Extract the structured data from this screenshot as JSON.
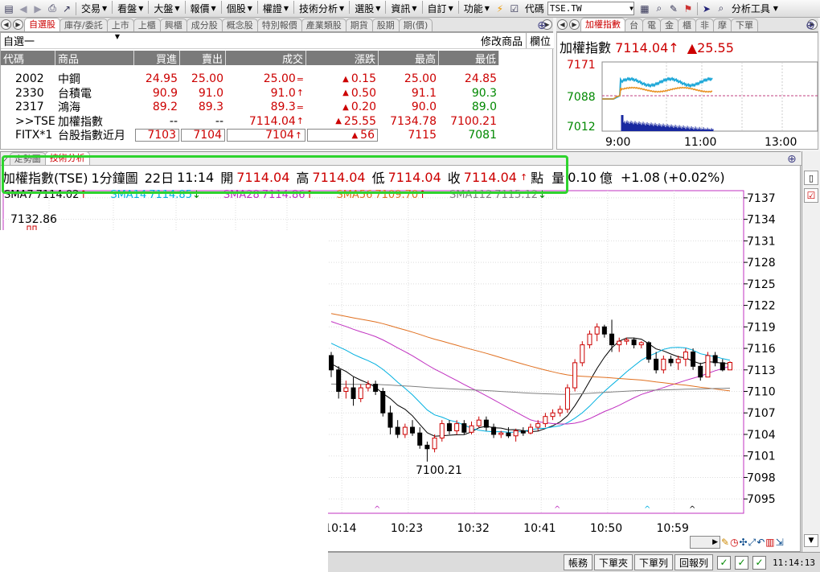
{
  "menu": {
    "items": [
      "交易",
      "看盤",
      "大盤",
      "報價",
      "個股",
      "權證",
      "技術分析",
      "選股",
      "資訊",
      "自訂",
      "功能"
    ],
    "code_label": "代碼",
    "code_value": "TSE.TW",
    "analysis_tool": "分析工具"
  },
  "watch_tabs": [
    "自選股",
    "庫存/委託",
    "上市",
    "上櫃",
    "興櫃",
    "成分股",
    "概念股",
    "特別報價",
    "產業類股",
    "期貨",
    "股期",
    "期(價)"
  ],
  "watch": {
    "group": "自選一",
    "edit_label": "修改商品",
    "column_label": "欄位",
    "columns": [
      "代碼",
      "商品",
      "買進",
      "賣出",
      "成交",
      "漲跌",
      "最高",
      "最低"
    ],
    "rows": [
      {
        "code": "2002",
        "name": "中鋼",
        "bid": "24.95",
        "ask": "25.00",
        "last": "25.00",
        "mark": "=",
        "chg": "0.15",
        "high": "25.00",
        "low": "24.85"
      },
      {
        "code": "2330",
        "name": "台積電",
        "bid": "90.9",
        "ask": "91.0",
        "last": "91.0",
        "mark": "↑",
        "chg": "0.50",
        "high": "91.1",
        "low": "90.3"
      },
      {
        "code": "2317",
        "name": "鴻海",
        "bid": "89.2",
        "ask": "89.3",
        "last": "89.3",
        "mark": "=",
        "chg": "0.20",
        "high": "90.0",
        "low": "89.0"
      },
      {
        "code": ">>TSE",
        "name": "加權指數",
        "bid": "--",
        "ask": "--",
        "last": "7114.04",
        "mark": "↑",
        "chg": "25.55",
        "high": "7134.78",
        "low": "7100.21"
      },
      {
        "code": "FITX*1",
        "name": "台股指數近月",
        "bid": "7103",
        "ask": "7104",
        "last": "7104",
        "mark": "↑",
        "chg": "56",
        "high": "7115",
        "low": "7081"
      }
    ]
  },
  "mini_tabs": [
    "加權指數",
    "台",
    "電",
    "金",
    "櫃",
    "非",
    "摩",
    "下單"
  ],
  "mini": {
    "title": "加權指數",
    "value": "7114.04",
    "arrow": "↑",
    "change": "▲25.55",
    "yticks": [
      "7171",
      "7088",
      "7012"
    ],
    "xticks": [
      "9:00",
      "11:00",
      "13:00"
    ]
  },
  "tech_tabs": [
    "走勢圖",
    "技術分析"
  ],
  "info": {
    "name": "加權指數(TSE)",
    "period": "1分鐘圖",
    "date": "22日",
    "time": "11:14",
    "open_label": "開",
    "open": "7114.04",
    "high_label": "高",
    "high": "7114.04",
    "low_label": "低",
    "low": "7114.04",
    "close_label": "收",
    "close": "7114.04",
    "close_arrow": "↑",
    "unit": "點",
    "vol_label": "量",
    "vol": "0.10",
    "vol_unit": "億",
    "change": "+1.08",
    "pct": "(+0.02%)"
  },
  "ma": [
    {
      "label": "SMA7",
      "value": "7114.02",
      "arrow": "↑",
      "color": "#000000"
    },
    {
      "label": "SMA14",
      "value": "7114.85",
      "arrow": "↓",
      "color": "#00b0e0"
    },
    {
      "label": "SMA28",
      "value": "7114.86",
      "arrow": "↑",
      "color": "#c030c0"
    },
    {
      "label": "SMA56",
      "value": "7109.70",
      "arrow": "↑",
      "color": "#e07020"
    },
    {
      "label": "SMA112",
      "value": "7115.12",
      "arrow": "↓",
      "color": "#808080"
    }
  ],
  "chart_data": {
    "type": "candlestick",
    "yticks": [
      "7137",
      "7134",
      "7131",
      "7128",
      "7125",
      "7122",
      "7119",
      "7116",
      "7113",
      "7110",
      "7107",
      "7104",
      "7101",
      "7098",
      "7095"
    ],
    "xticks": [
      "10:14",
      "10:23",
      "10:32",
      "10:41",
      "10:50",
      "10:59"
    ],
    "ylim": [
      7093,
      7138
    ],
    "high_label": "7132.86",
    "low_label": "7100.21",
    "candles": [
      {
        "o": 7115,
        "h": 7115.5,
        "l": 7112,
        "c": 7113
      },
      {
        "o": 7113,
        "h": 7113.5,
        "l": 7109,
        "c": 7110
      },
      {
        "o": 7110,
        "h": 7111.5,
        "l": 7109,
        "c": 7110.5
      },
      {
        "o": 7110.5,
        "h": 7112,
        "l": 7108,
        "c": 7109
      },
      {
        "o": 7109,
        "h": 7111,
        "l": 7108.5,
        "c": 7110.5
      },
      {
        "o": 7110.5,
        "h": 7111.5,
        "l": 7110,
        "c": 7111
      },
      {
        "o": 7111,
        "h": 7111.5,
        "l": 7109.5,
        "c": 7110
      },
      {
        "o": 7110,
        "h": 7110.5,
        "l": 7106.5,
        "c": 7107
      },
      {
        "o": 7107,
        "h": 7108,
        "l": 7104,
        "c": 7105
      },
      {
        "o": 7105,
        "h": 7106,
        "l": 7103.5,
        "c": 7104
      },
      {
        "o": 7104,
        "h": 7105.5,
        "l": 7103.5,
        "c": 7105
      },
      {
        "o": 7105,
        "h": 7106,
        "l": 7103.8,
        "c": 7104.2
      },
      {
        "o": 7104.2,
        "h": 7105,
        "l": 7102,
        "c": 7102.5
      },
      {
        "o": 7102.5,
        "h": 7103,
        "l": 7100.21,
        "c": 7102
      },
      {
        "o": 7102,
        "h": 7104,
        "l": 7101.5,
        "c": 7103.5
      },
      {
        "o": 7103.5,
        "h": 7106,
        "l": 7103,
        "c": 7105.5
      },
      {
        "o": 7105.5,
        "h": 7106,
        "l": 7104,
        "c": 7104.5
      },
      {
        "o": 7104.5,
        "h": 7106,
        "l": 7104,
        "c": 7105.5
      },
      {
        "o": 7105.5,
        "h": 7106,
        "l": 7104,
        "c": 7104.3
      },
      {
        "o": 7104.3,
        "h": 7105.8,
        "l": 7104,
        "c": 7105.2
      },
      {
        "o": 7105.2,
        "h": 7106.5,
        "l": 7105,
        "c": 7106
      },
      {
        "o": 7106,
        "h": 7106.5,
        "l": 7104.5,
        "c": 7105
      },
      {
        "o": 7105,
        "h": 7105.5,
        "l": 7103.5,
        "c": 7104
      },
      {
        "o": 7104,
        "h": 7104.5,
        "l": 7103.5,
        "c": 7104.2
      },
      {
        "o": 7104.2,
        "h": 7105,
        "l": 7103.5,
        "c": 7103.8
      },
      {
        "o": 7103.8,
        "h": 7104.8,
        "l": 7103,
        "c": 7104.5
      },
      {
        "o": 7104.5,
        "h": 7105,
        "l": 7103.8,
        "c": 7104.2
      },
      {
        "o": 7104.2,
        "h": 7105.5,
        "l": 7104,
        "c": 7105
      },
      {
        "o": 7105,
        "h": 7106,
        "l": 7104.5,
        "c": 7105.5
      },
      {
        "o": 7105.5,
        "h": 7107,
        "l": 7105,
        "c": 7106.5
      },
      {
        "o": 7106.5,
        "h": 7107.5,
        "l": 7106,
        "c": 7107
      },
      {
        "o": 7107,
        "h": 7108,
        "l": 7106.5,
        "c": 7107.5
      },
      {
        "o": 7107.5,
        "h": 7111,
        "l": 7107,
        "c": 7110.5
      },
      {
        "o": 7110.5,
        "h": 7114.5,
        "l": 7110,
        "c": 7114
      },
      {
        "o": 7114,
        "h": 7117,
        "l": 7113.5,
        "c": 7116.5
      },
      {
        "o": 7116.5,
        "h": 7118.5,
        "l": 7116,
        "c": 7118
      },
      {
        "o": 7118,
        "h": 7119.5,
        "l": 7117,
        "c": 7119
      },
      {
        "o": 7119,
        "h": 7119.3,
        "l": 7117.5,
        "c": 7118
      },
      {
        "o": 7118,
        "h": 7120,
        "l": 7115.5,
        "c": 7116.5
      },
      {
        "o": 7116.5,
        "h": 7117.5,
        "l": 7115.5,
        "c": 7117
      },
      {
        "o": 7117,
        "h": 7117.5,
        "l": 7116.5,
        "c": 7117.2
      },
      {
        "o": 7117.2,
        "h": 7117.5,
        "l": 7116,
        "c": 7116.5
      },
      {
        "o": 7116.5,
        "h": 7117,
        "l": 7116,
        "c": 7116.8
      },
      {
        "o": 7116.8,
        "h": 7117,
        "l": 7114,
        "c": 7114.5
      },
      {
        "o": 7114.5,
        "h": 7115.5,
        "l": 7112.5,
        "c": 7113
      },
      {
        "o": 7113,
        "h": 7115,
        "l": 7112.5,
        "c": 7114.5
      },
      {
        "o": 7114.5,
        "h": 7115,
        "l": 7113.5,
        "c": 7114
      },
      {
        "o": 7114,
        "h": 7115,
        "l": 7113,
        "c": 7114.5
      },
      {
        "o": 7114.5,
        "h": 7116,
        "l": 7113.5,
        "c": 7115.5
      },
      {
        "o": 7115.5,
        "h": 7116,
        "l": 7113,
        "c": 7113.5
      },
      {
        "o": 7113.5,
        "h": 7114,
        "l": 7111.5,
        "c": 7112
      },
      {
        "o": 7112,
        "h": 7115.5,
        "l": 7112,
        "c": 7115
      },
      {
        "o": 7115,
        "h": 7115.5,
        "l": 7113.5,
        "c": 7114
      },
      {
        "o": 7114,
        "h": 7114.5,
        "l": 7112.8,
        "c": 7113
      },
      {
        "o": 7113,
        "h": 7114.2,
        "l": 7113,
        "c": 7114.04
      }
    ]
  },
  "status": {
    "buttons": [
      "帳務",
      "下單夾",
      "下單列",
      "回報列"
    ],
    "time": "11:14:13"
  }
}
